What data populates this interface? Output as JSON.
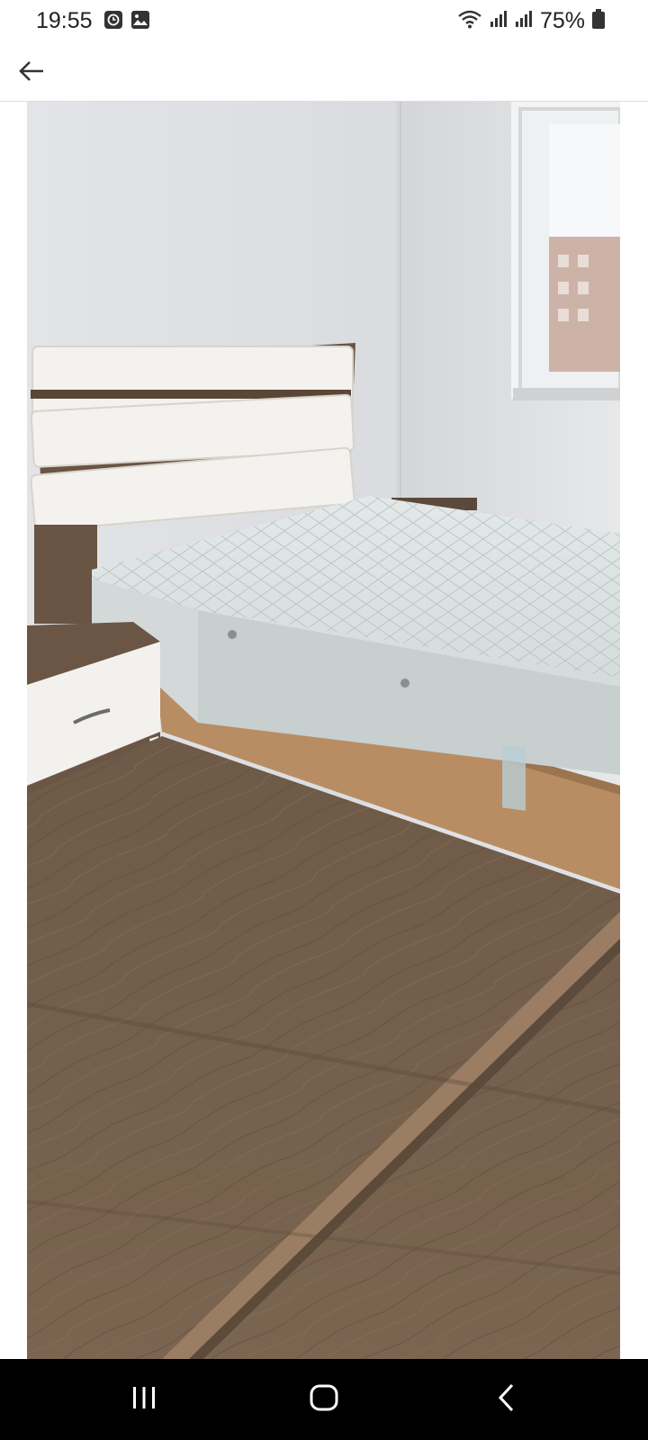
{
  "status_bar": {
    "time": "19:55",
    "battery_percent": "75%",
    "left_icons": [
      "clock-notification-icon",
      "gallery-notification-icon"
    ],
    "right_icons": [
      "wifi-icon",
      "signal-icon",
      "signal-icon",
      "battery-icon"
    ]
  },
  "app_bar": {
    "back_icon": "arrow-left-icon"
  },
  "viewer": {
    "content": "photo"
  },
  "nav_bar": {
    "buttons": [
      "recent-apps-icon",
      "home-icon",
      "back-icon"
    ]
  },
  "colors": {
    "background": "#ffffff",
    "nav_bar": "#000000",
    "text": "#222222",
    "divider": "#dcdcdc"
  }
}
